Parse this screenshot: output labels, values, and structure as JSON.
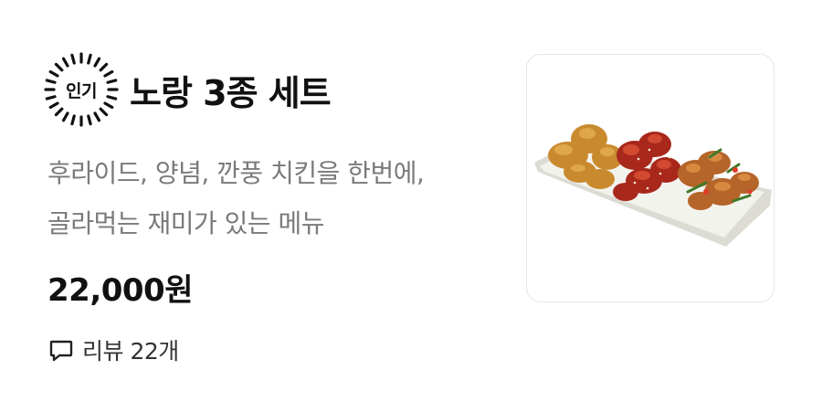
{
  "menu_item": {
    "badge_label": "인기",
    "title": "노랑 3종 세트",
    "description_lines": [
      "후라이드, 양념, 깐풍 치킨을 한번에,",
      "골라먹는 재미가 있는 메뉴"
    ],
    "price": "22,000원",
    "review_label": "리뷰 22개",
    "photo_icon": "chicken-platter-photo"
  }
}
